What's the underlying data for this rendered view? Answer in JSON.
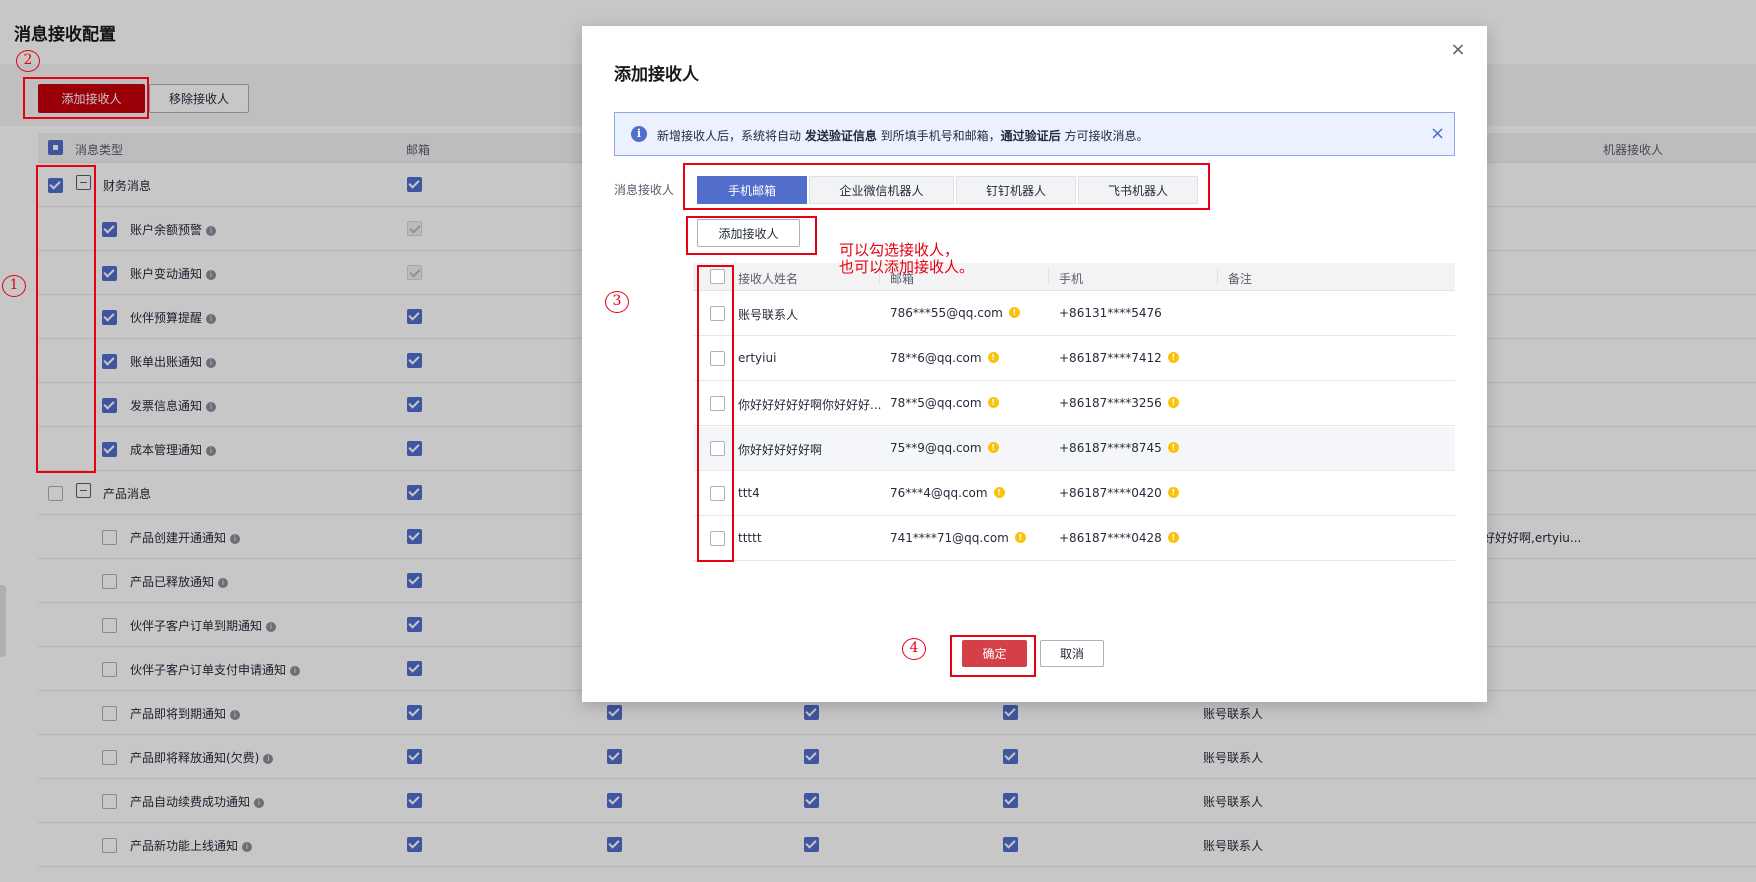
{
  "page": {
    "title": "消息接收配置",
    "add_btn": "添加接收人",
    "remove_btn": "移除接收人"
  },
  "table": {
    "headers": {
      "type": "消息类型",
      "email": "邮箱",
      "robot": "机器接收人"
    },
    "groups": [
      {
        "label": "财务消息",
        "checked": "on"
      },
      {
        "label": "产品消息",
        "checked": "off"
      }
    ],
    "rows": [
      {
        "label": "账户余额预警",
        "email": "dis"
      },
      {
        "label": "账户变动通知",
        "email": "dis"
      },
      {
        "label": "伙伴预算提醒",
        "email": "on"
      },
      {
        "label": "账单出账通知",
        "email": "on"
      },
      {
        "label": "发票信息通知",
        "email": "on"
      },
      {
        "label": "成本管理通知",
        "email": "on"
      },
      {
        "label": "产品创建开通通知",
        "email": "on",
        "extra": "好好好啊,ertyiu..."
      },
      {
        "label": "产品已释放通知",
        "email": "on"
      },
      {
        "label": "伙伴子客户订单到期通知",
        "email": "on"
      },
      {
        "label": "伙伴子客户订单支付申请通知",
        "email": "on"
      },
      {
        "label": "产品即将到期通知",
        "email": "on",
        "recipient": "账号联系人"
      },
      {
        "label": "产品即将释放通知(欠费)",
        "email": "on",
        "recipient": "账号联系人"
      },
      {
        "label": "产品自动续费成功通知",
        "email": "on",
        "recipient": "账号联系人"
      },
      {
        "label": "产品新功能上线通知",
        "email": "on",
        "recipient": "账号联系人"
      }
    ]
  },
  "modal": {
    "title": "添加接收人",
    "close": "×",
    "alert": {
      "t1": "新增接收人后，系统将自动 ",
      "b1": "发送验证信息",
      "t2": " 到所填手机号和邮箱，",
      "b2": "通过验证后",
      "t3": " 方可接收消息。",
      "close": "×"
    },
    "recv_label": "消息接收人",
    "tabs": [
      {
        "label": "手机邮箱",
        "active": true
      },
      {
        "label": "企业微信机器人",
        "active": false
      },
      {
        "label": "钉钉机器人",
        "active": false
      },
      {
        "label": "飞书机器人",
        "active": false
      }
    ],
    "add_btn": "添加接收人",
    "columns": {
      "name": "接收人姓名",
      "email": "邮箱",
      "phone": "手机",
      "remark": "备注"
    },
    "rows": [
      {
        "name": "账号联系人",
        "email": "786***55@qq.com",
        "phone": "+86131****5476",
        "phone_warn": false
      },
      {
        "name": "ertyiui",
        "email": "78**6@qq.com",
        "phone": "+86187****7412",
        "phone_warn": true
      },
      {
        "name": "你好好好好好啊你好好好...",
        "email": "78**5@qq.com",
        "phone": "+86187****3256",
        "phone_warn": true
      },
      {
        "name": "你好好好好好啊",
        "email": "75**9@qq.com",
        "phone": "+86187****8745",
        "phone_warn": true
      },
      {
        "name": "ttt4",
        "email": "76***4@qq.com",
        "phone": "+86187****0420",
        "phone_warn": true
      },
      {
        "name": "ttttt",
        "email": "741****71@qq.com",
        "phone": "+86187****0428",
        "phone_warn": true
      }
    ],
    "ok_btn": "确定",
    "cancel_btn": "取消"
  },
  "annotations": {
    "c1": "1",
    "c2": "2",
    "c3": "3",
    "c4": "4",
    "note_line1": "可以勾选接收人，",
    "note_line2": "也可以添加接收人。"
  },
  "colors": {
    "brand_red": "#c7000b",
    "primary": "#526ecc",
    "annotation": "#e60012",
    "warn": "#fac20a"
  }
}
